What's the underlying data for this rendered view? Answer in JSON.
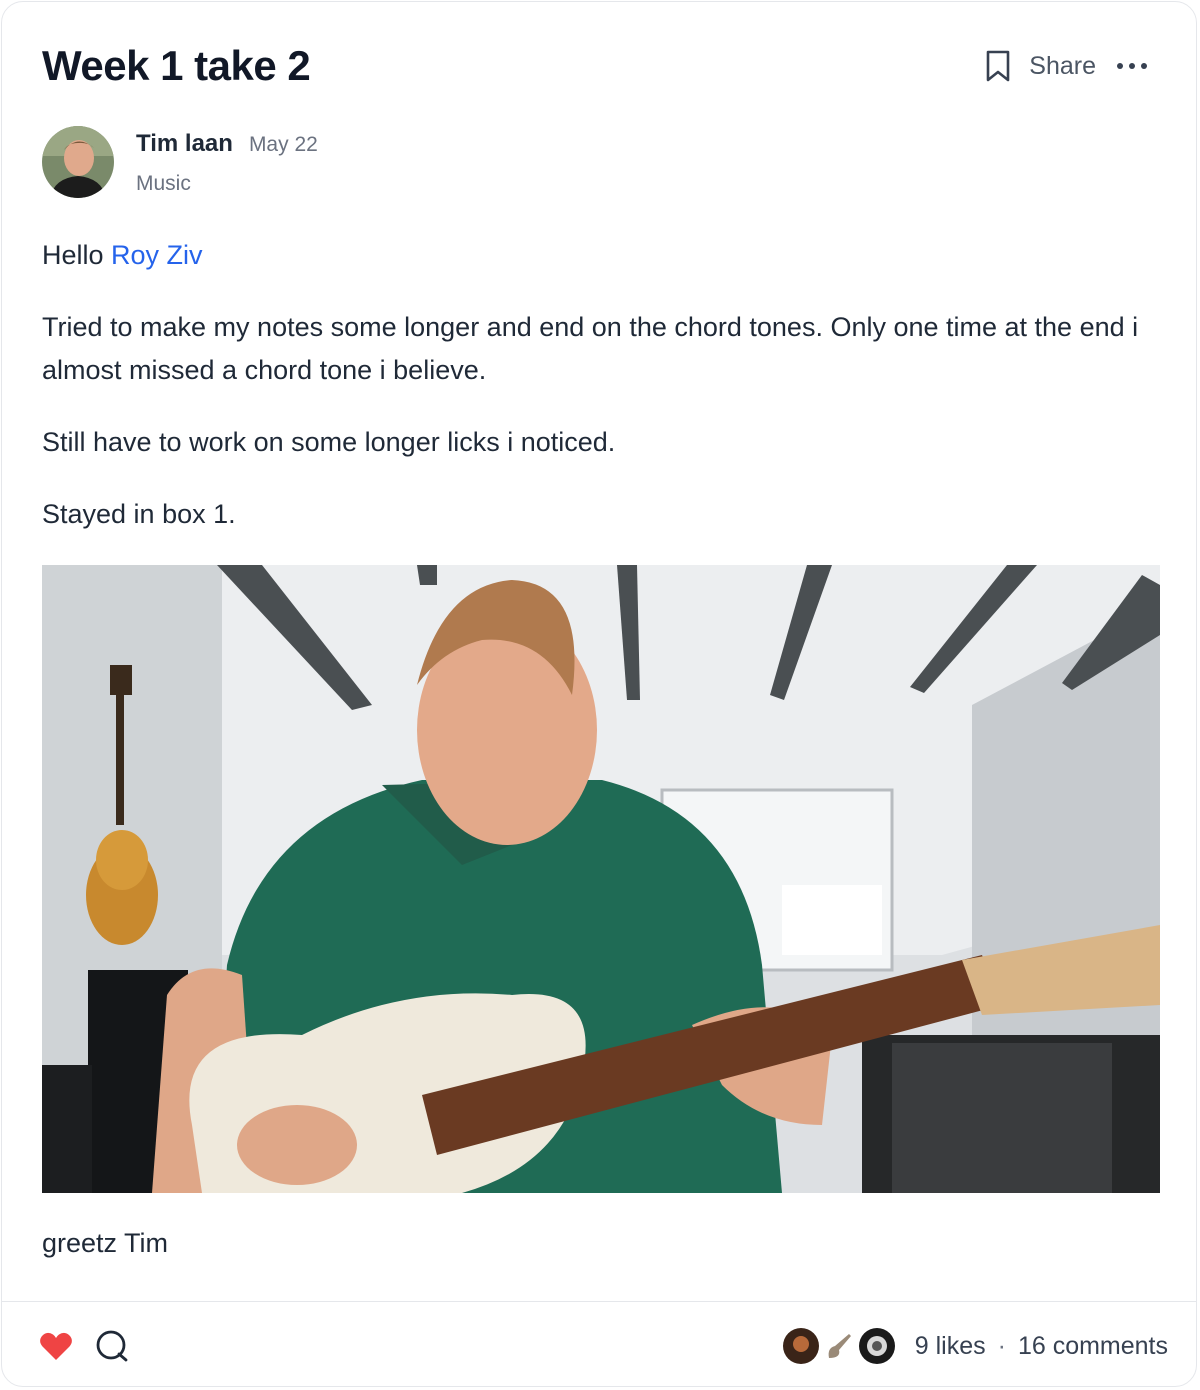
{
  "post": {
    "title": "Week 1 take 2",
    "share_label": "Share",
    "author": {
      "name": "Tim laan",
      "date": "May 22",
      "category": "Music"
    },
    "greeting_prefix": "Hello ",
    "mention": "Roy Ziv",
    "paragraphs": [
      "Tried to make my notes some longer and end on the chord tones. Only one time at the end i almost missed a chord tone i believe.",
      "Still have to work on some longer licks i noticed.",
      "Stayed in box 1."
    ],
    "signoff": "greetz Tim"
  },
  "footer": {
    "likes": "9 likes",
    "separator": "·",
    "comments": "16 comments"
  },
  "colors": {
    "mention": "#2563eb",
    "heart": "#ef4444",
    "shirt": "#1f6b55"
  },
  "icons": [
    "bookmark-icon",
    "more-dots-icon",
    "heart-icon",
    "comment-icon"
  ]
}
